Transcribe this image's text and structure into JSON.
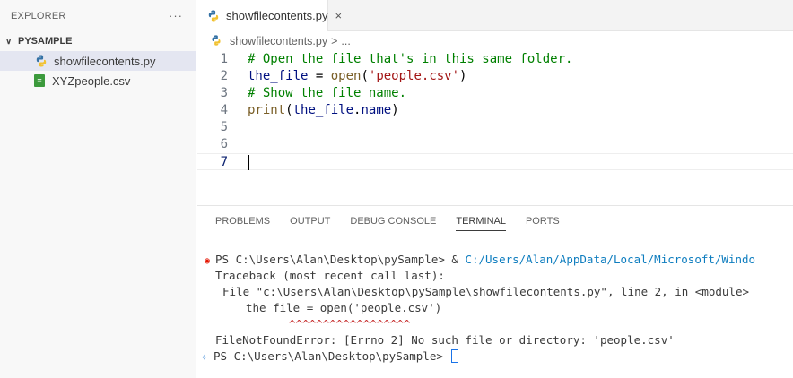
{
  "sidebar": {
    "title": "EXPLORER",
    "more": "···",
    "folder": "PYSAMPLE",
    "files": [
      {
        "name": "showfilecontents.py",
        "icon": "python-file-icon",
        "selected": true
      },
      {
        "name": "XYZpeople.csv",
        "icon": "csv-file-icon",
        "selected": false
      }
    ]
  },
  "editor": {
    "tab": {
      "label": "showfilecontents.py",
      "close": "×"
    },
    "breadcrumb": {
      "file": "showfilecontents.py",
      "sep": ">",
      "more": "..."
    },
    "lines": [
      {
        "num": "1",
        "text": "# Open the file that's in this same folder."
      },
      {
        "num": "2",
        "text": "the_file = open('people.csv')"
      },
      {
        "num": "3",
        "text": "# Show the file name."
      },
      {
        "num": "4",
        "text": "print(the_file.name)"
      },
      {
        "num": "5",
        "text": ""
      },
      {
        "num": "6",
        "text": ""
      },
      {
        "num": "7",
        "text": ""
      }
    ],
    "active_line": "7"
  },
  "panel": {
    "tabs": [
      "PROBLEMS",
      "OUTPUT",
      "DEBUG CONSOLE",
      "TERMINAL",
      "PORTS"
    ],
    "active_tab": "TERMINAL",
    "terminal": {
      "prompt1": "PS C:\\Users\\Alan\\Desktop\\pySample> & ",
      "command_path": "C:/Users/Alan/AppData/Local/Microsoft/Windo",
      "traceback": "Traceback (most recent call last):",
      "file_line": "File \"c:\\Users\\Alan\\Desktop\\pySample\\showfilecontents.py\", line 2, in <module>",
      "code_line": "the_file = open('people.csv')",
      "carets": "^^^^^^^^^^^^^^^^^^",
      "error": "FileNotFoundError: [Errno 2] No such file or directory: 'people.csv'",
      "prompt2": "PS C:\\Users\\Alan\\Desktop\\pySample> "
    }
  },
  "colors": {
    "comment": "#008000",
    "string": "#a31515",
    "function": "#795e26",
    "variable": "#001080",
    "error_dot": "#e51400",
    "link": "#0e7dbf"
  }
}
